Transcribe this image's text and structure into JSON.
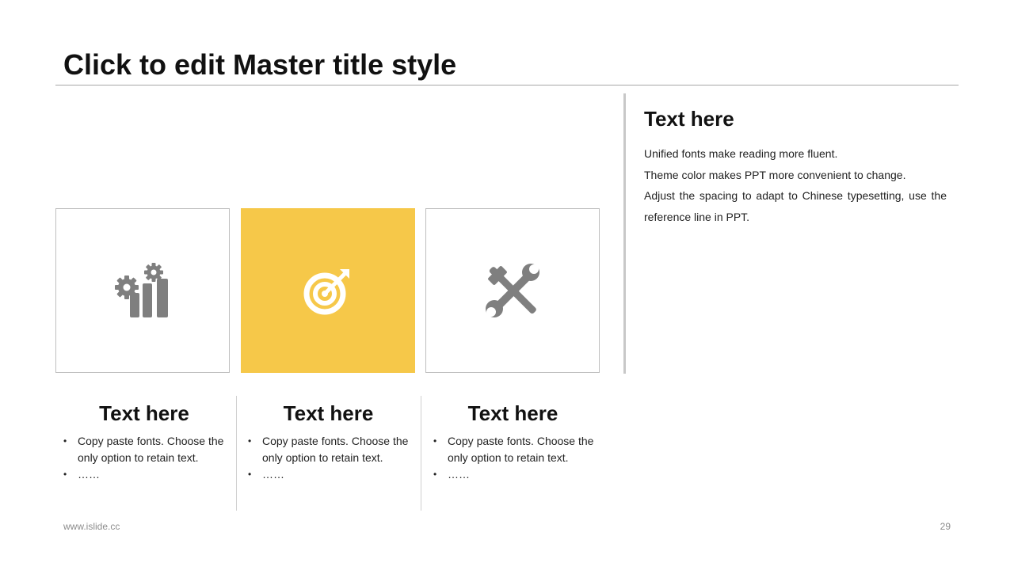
{
  "slide": {
    "title": "Click to edit Master title style",
    "accent_color": "#F6C849",
    "icon_color": "#7f7f7f",
    "footer_url": "www.islide.cc",
    "page_number": "29"
  },
  "icons": [
    {
      "name": "gears-bar-chart-icon"
    },
    {
      "name": "target-arrow-icon"
    },
    {
      "name": "tools-icon"
    }
  ],
  "side": {
    "heading": "Text here",
    "lines": [
      "Unified fonts make reading more fluent.",
      "Theme color makes PPT more convenient to change.",
      "Adjust the spacing to adapt to Chinese typesetting, use the",
      "reference line in PPT."
    ]
  },
  "columns": [
    {
      "heading": "Text here",
      "bullets": [
        "Copy paste fonts. Choose the only option to retain text.",
        "……"
      ]
    },
    {
      "heading": "Text here",
      "bullets": [
        "Copy paste fonts. Choose the only option to retain text.",
        "……"
      ]
    },
    {
      "heading": "Text here",
      "bullets": [
        "Copy paste fonts. Choose the only option to retain text.",
        "……"
      ]
    }
  ]
}
